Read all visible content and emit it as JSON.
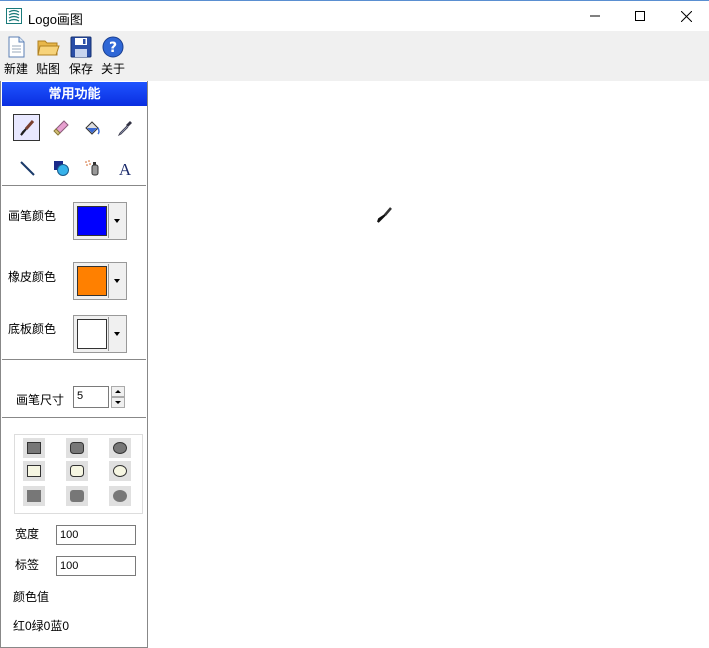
{
  "window": {
    "title": "Logo画图"
  },
  "toolbar": {
    "new_label": "新建",
    "paste_label": "贴图",
    "save_label": "保存",
    "about_label": "关于"
  },
  "panel": {
    "header": "常用功能",
    "tools": [
      "brush-icon",
      "eraser-icon",
      "fill-icon",
      "eyedropper-icon",
      "line-icon",
      "shape-icon",
      "spray-icon",
      "text-icon"
    ],
    "pen_color_label": "画笔颜色",
    "pen_color": "#0000ff",
    "eraser_color_label": "橡皮颜色",
    "eraser_color": "#ff8000",
    "bg_color_label": "底板颜色",
    "bg_color": "#ffffff",
    "pen_size_label": "画笔尺寸",
    "pen_size_value": "5",
    "width_label": "宽度",
    "width_value": "100",
    "tag_label": "标签",
    "tag_value": "100",
    "color_value_label": "颜色值",
    "rgb_text": "红0绿0蓝0"
  }
}
